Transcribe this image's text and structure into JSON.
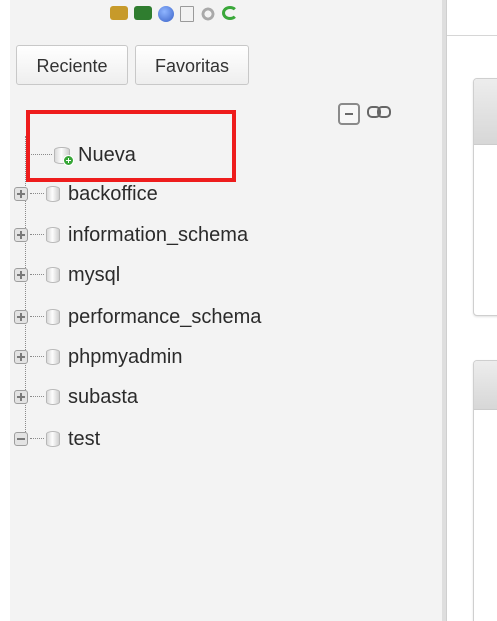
{
  "toolbar": {
    "icons": [
      "home-icon",
      "database-icon",
      "help-icon",
      "documentation-icon",
      "settings-icon",
      "reload-icon"
    ]
  },
  "tabs": [
    {
      "label": "Reciente"
    },
    {
      "label": "Favoritas"
    }
  ],
  "tree": {
    "new_item": {
      "label": "Nueva"
    },
    "databases": [
      {
        "label": "backoffice",
        "expander": "plus"
      },
      {
        "label": "information_schema",
        "expander": "plus"
      },
      {
        "label": "mysql",
        "expander": "plus"
      },
      {
        "label": "performance_schema",
        "expander": "plus"
      },
      {
        "label": "phpmyadmin",
        "expander": "plus"
      },
      {
        "label": "subasta",
        "expander": "plus"
      },
      {
        "label": "test",
        "expander": "minus"
      }
    ]
  },
  "colors": {
    "highlight": "#ee1c1c",
    "nav_background": "#f3f3f3",
    "text": "#2b2b2b"
  }
}
